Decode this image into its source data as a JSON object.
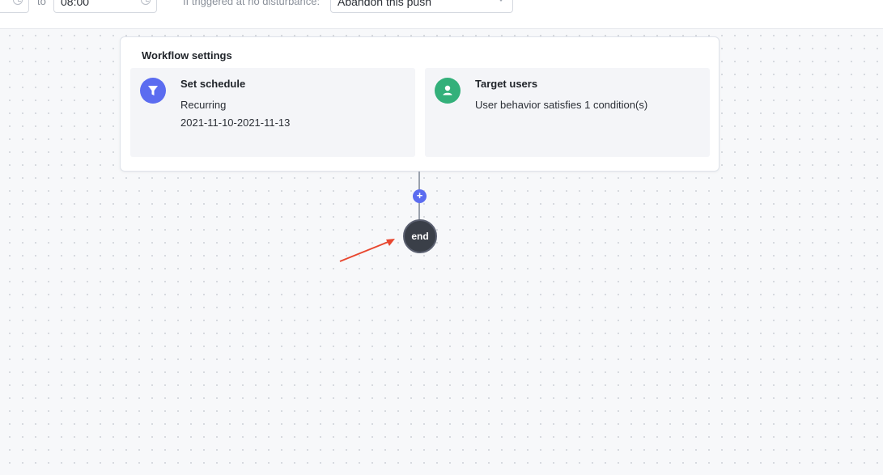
{
  "topbar": {
    "start_time": "",
    "to_label": "to",
    "end_time": "08:00",
    "dnd_label": "If triggered at no disturbance:",
    "dnd_option": "Abandon this push"
  },
  "workflow": {
    "title": "Workflow settings",
    "schedule": {
      "title": "Set schedule",
      "type": "Recurring",
      "range": "2021-11-10-2021-11-13",
      "icon": "filter-icon",
      "color": "#5b6cf0"
    },
    "target": {
      "title": "Target users",
      "condition": "User behavior satisfies 1 condition(s)",
      "icon": "user-icon",
      "color": "#33b07a"
    }
  },
  "flow": {
    "add_label": "+",
    "end_label": "end"
  },
  "annotation": {
    "arrow_color": "#e8472f"
  }
}
